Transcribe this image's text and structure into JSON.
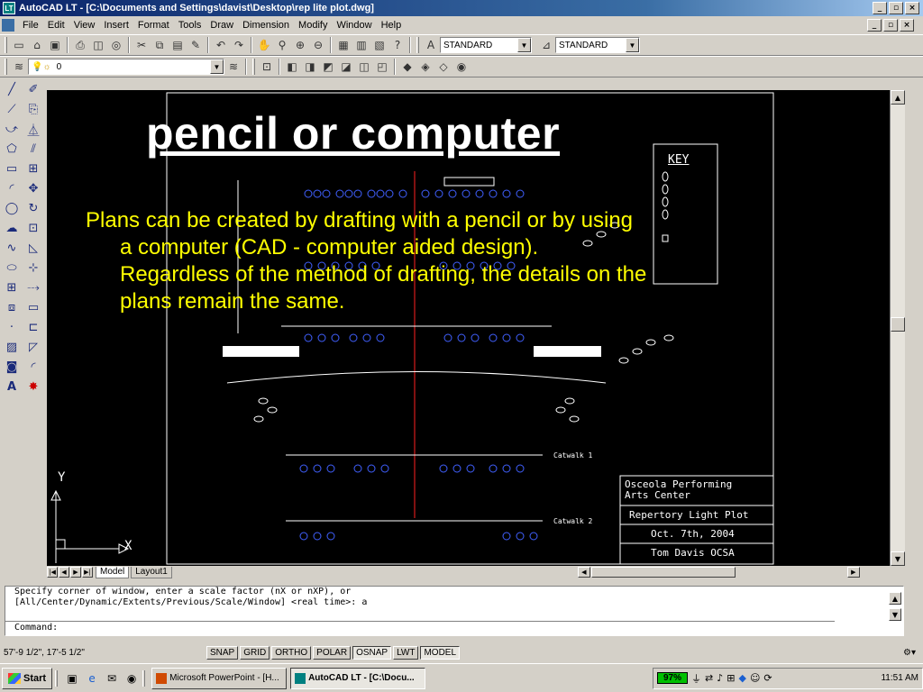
{
  "window": {
    "title": "AutoCAD LT - [C:\\Documents and Settings\\davist\\Desktop\\rep lite plot.dwg]",
    "min_btn": "_",
    "max_btn": "▫",
    "close_btn": "×"
  },
  "menubar": {
    "items": [
      "File",
      "Edit",
      "View",
      "Insert",
      "Format",
      "Tools",
      "Draw",
      "Dimension",
      "Modify",
      "Window",
      "Help"
    ]
  },
  "toolbar": {
    "text_style": "STANDARD",
    "dim_style": "STANDARD",
    "layer": "0"
  },
  "slide": {
    "title": "pencil or computer",
    "line1": "Plans can be created by drafting with a pencil or by using",
    "line2": "a computer (CAD - computer aided design).",
    "line3": "Regardless of the method of drafting, the details on the",
    "line4": "plans remain the same."
  },
  "drawing": {
    "key_label": "KEY",
    "catwalk1": "Catwalk 1",
    "catwalk2": "Catwalk 2",
    "title_block": {
      "venue": "Osceola Performing\nArts Center",
      "plot": "Repertory Light Plot",
      "date": "Oct. 7th, 2004",
      "designer": "Tom Davis OCSA"
    },
    "ucs_x": "X",
    "ucs_y": "Y"
  },
  "tabs": {
    "model": "Model",
    "layout": "Layout1"
  },
  "command": {
    "line1": "Specify corner of window, enter a scale factor (nX or nXP), or",
    "line2": "[All/Center/Dynamic/Extents/Previous/Scale/Window] <real time>: a",
    "prompt": "Command:"
  },
  "status": {
    "coords": "57'-9 1/2\",  17'-5 1/2\"",
    "toggles": [
      "SNAP",
      "GRID",
      "ORTHO",
      "POLAR",
      "OSNAP",
      "LWT",
      "MODEL"
    ]
  },
  "taskbar": {
    "start": "Start",
    "task1": "Microsoft PowerPoint - [H...",
    "task2": "AutoCAD LT - [C:\\Docu...",
    "battery": "97%",
    "clock": "11:51 AM"
  }
}
